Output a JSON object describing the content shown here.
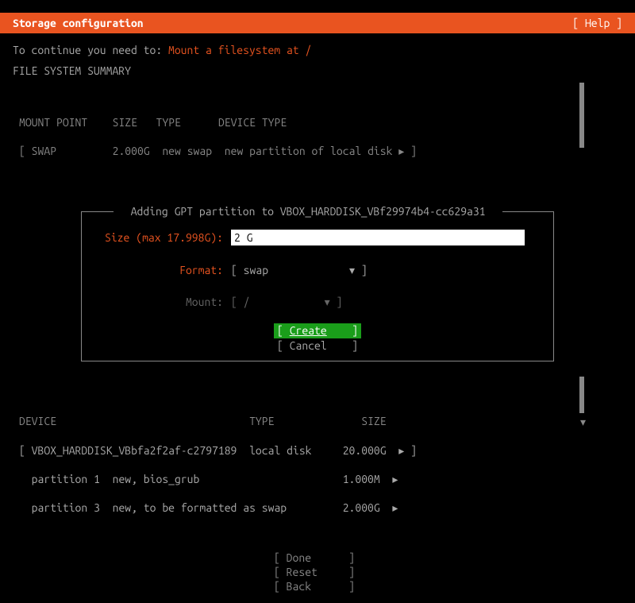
{
  "header": {
    "title": "Storage configuration",
    "help": "[ Help ]"
  },
  "hint": {
    "prefix": "To continue you need to: ",
    "action": "Mount a filesystem at /"
  },
  "summary": {
    "title": "FILE SYSTEM SUMMARY",
    "col_mount": "MOUNT POINT",
    "col_size": "SIZE",
    "col_type": "TYPE",
    "col_device": "DEVICE TYPE",
    "row0_mount": "[ SWAP",
    "row0_size": "2.000G",
    "row0_type": "new swap",
    "row0_device": "new partition of local disk ▸ ]"
  },
  "dialog": {
    "title": "Adding GPT partition to VBOX_HARDDISK_VBf29974b4-cc629a31",
    "size_label": "Size (max 17.998G):",
    "size_value": "2 G",
    "format_label": "Format:",
    "format_value": "[ swap             ▾ ]",
    "mount_label": "Mount:",
    "mount_value": "[ /            ▾ ]",
    "create_label_bracket_open": "[ ",
    "create_label_text": "Create",
    "create_label_bracket_close": "    ]",
    "cancel_label": "[ Cancel    ]"
  },
  "available": {
    "col_device": "DEVICE",
    "col_type": "TYPE",
    "col_size": "SIZE",
    "row0_device": "[ VBOX_HARDDISK_VBbfa2f2af-c2797189",
    "row0_type": "local disk",
    "row0_size": "20.000G",
    "row0_tail": "▸ ]",
    "row1_device": "  partition 1  new, bios_grub",
    "row1_size": "1.000M",
    "row1_tail": "▸",
    "row2_device": "  partition 3  new, to be formatted as swap",
    "row2_size": "2.000G",
    "row2_tail": "▸"
  },
  "footer": {
    "done": "[ Done      ]",
    "reset": "[ Reset     ]",
    "back": "[ Back      ]"
  }
}
